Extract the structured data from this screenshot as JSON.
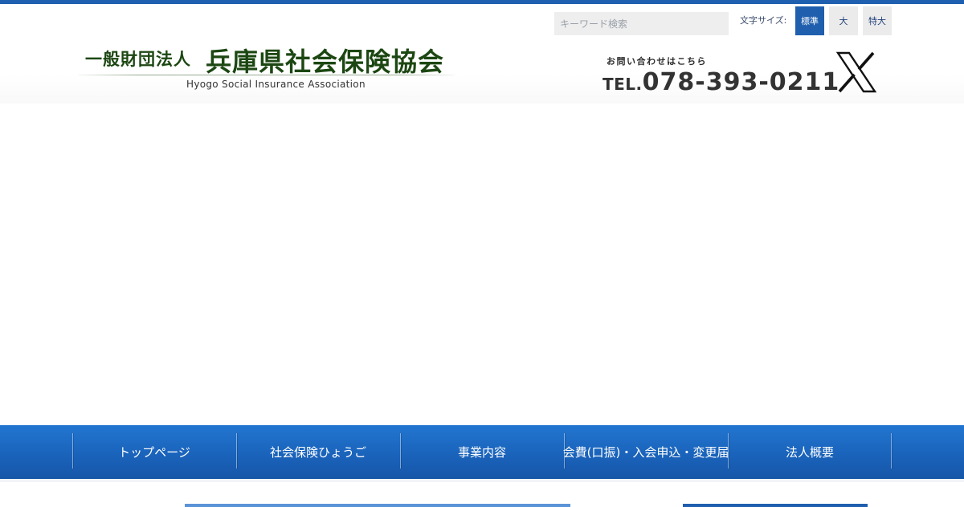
{
  "header": {
    "logo": {
      "org_type": "一般財団法人",
      "org_name": "兵庫県社会保険協会",
      "english_name": "Hyogo Social Insurance Association"
    },
    "search": {
      "placeholder": "キーワード検索",
      "value": ""
    },
    "font_size": {
      "label": "文字サイズ:",
      "options": [
        "標準",
        "大",
        "特大"
      ],
      "selected": "標準"
    },
    "contact": {
      "label": "お問い合わせはこちら",
      "tel_prefix": "TEL.",
      "tel_number": "078-393-0211"
    },
    "social_icon": "x-logo-icon"
  },
  "nav": {
    "items": [
      "トップページ",
      "社会保険ひょうご",
      "事業内容",
      "会費(口振)・入会申込・変更届",
      "法人概要"
    ]
  },
  "colors": {
    "brand_blue": "#1f5fae",
    "nav_gradient_top": "#2276d0",
    "nav_gradient_bottom": "#1656a8",
    "logo_green": "#1c4712"
  }
}
